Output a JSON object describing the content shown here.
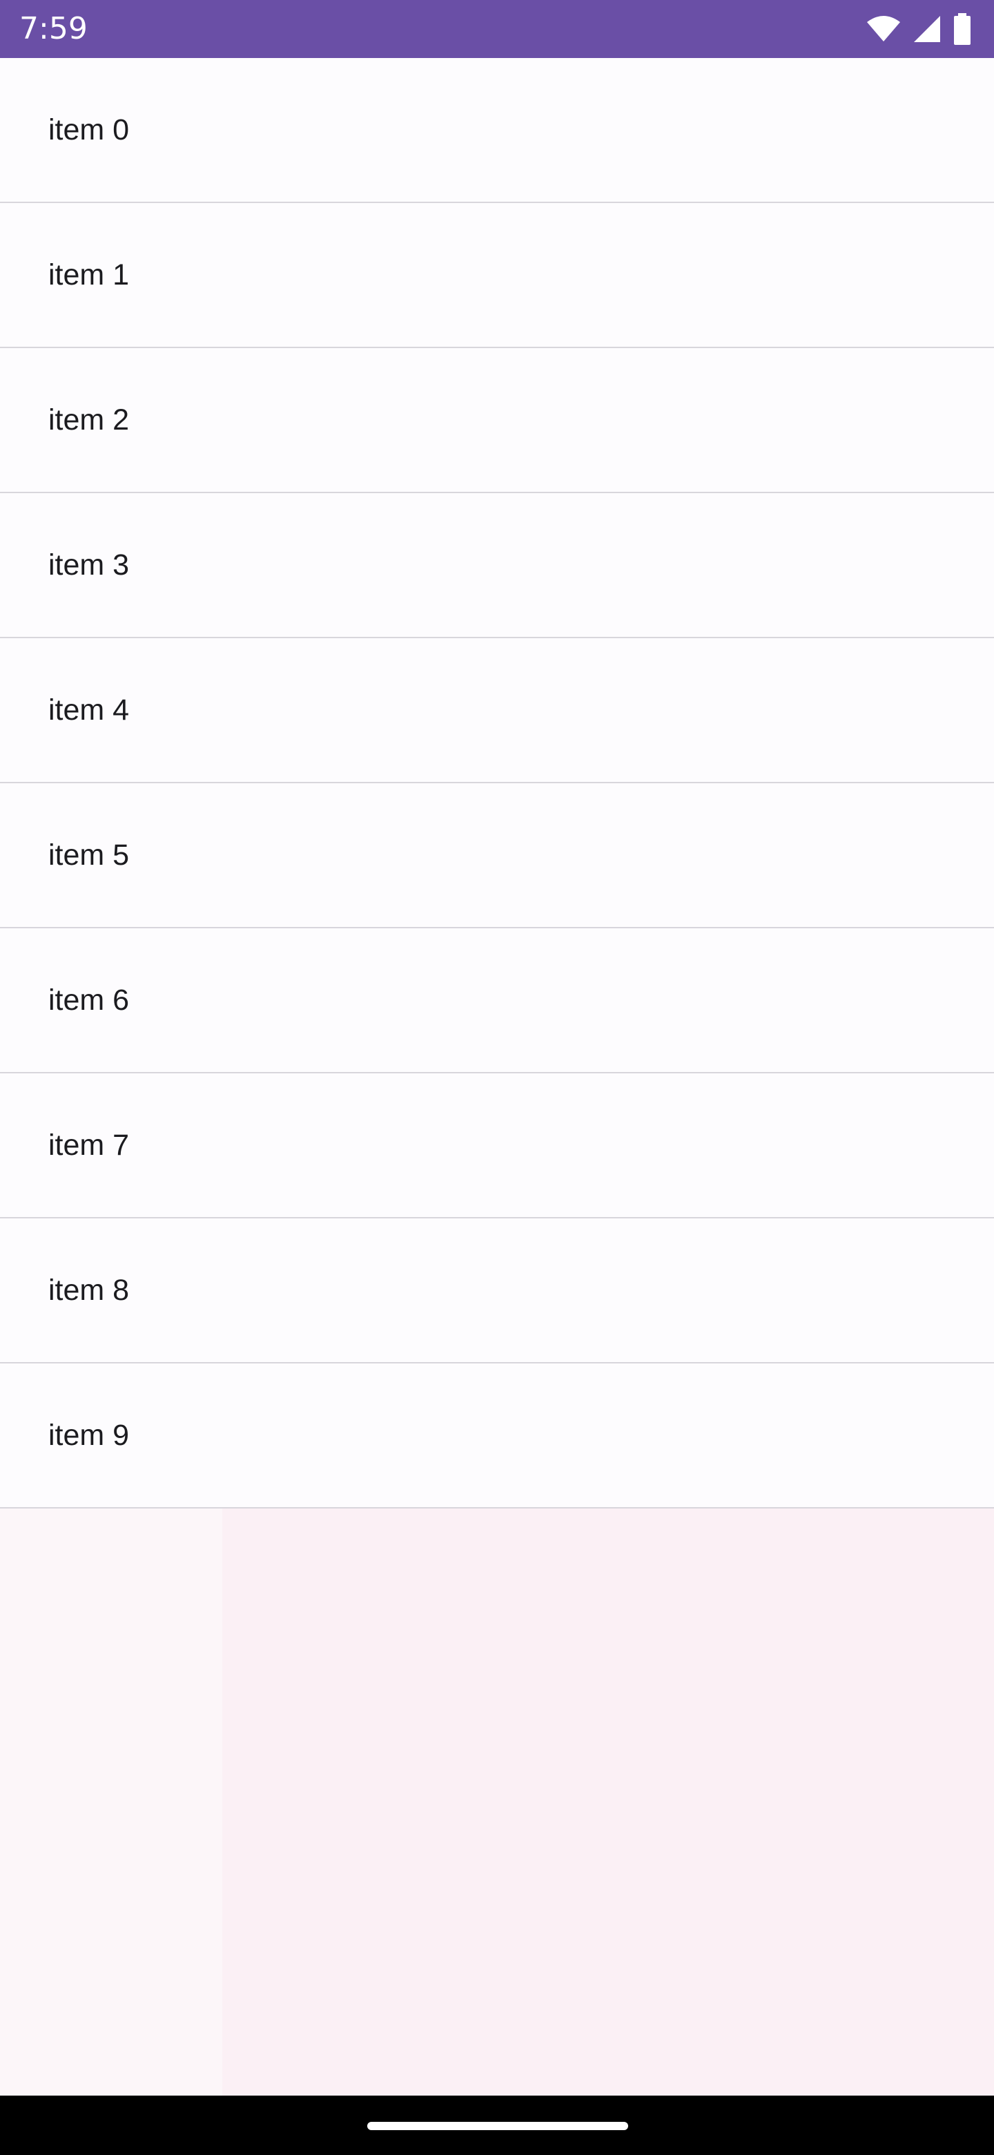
{
  "status_bar": {
    "time": "7:59",
    "background_color": "#6a4fa6",
    "icons": [
      "wifi-icon",
      "cellular-signal-icon",
      "battery-icon"
    ]
  },
  "list": {
    "items": [
      {
        "label": "item 0"
      },
      {
        "label": "item 1"
      },
      {
        "label": "item 2"
      },
      {
        "label": "item 3"
      },
      {
        "label": "item 4"
      },
      {
        "label": "item 5"
      },
      {
        "label": "item 6"
      },
      {
        "label": "item 7"
      },
      {
        "label": "item 8"
      },
      {
        "label": "item 9"
      }
    ]
  },
  "navigation_bar": {
    "handle": "home-gesture-handle"
  }
}
